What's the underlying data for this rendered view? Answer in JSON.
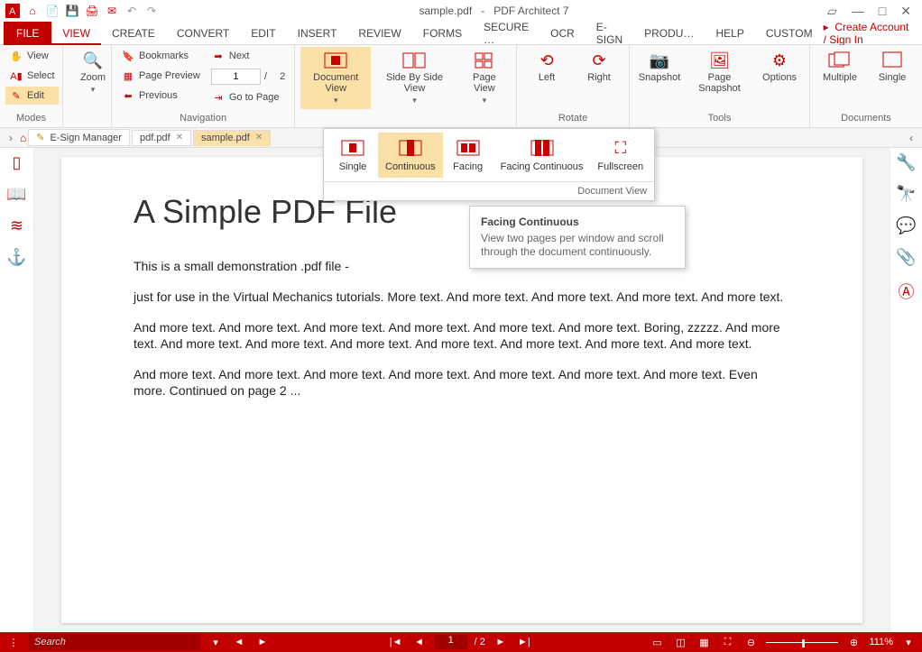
{
  "title": {
    "file": "sample.pdf",
    "sep": "-",
    "app": "PDF Architect 7"
  },
  "account": {
    "prefix": "▸",
    "text": "Create Account / Sign In"
  },
  "menu": [
    "FILE",
    "VIEW",
    "CREATE",
    "CONVERT",
    "EDIT",
    "INSERT",
    "REVIEW",
    "FORMS",
    "SECURE …",
    "OCR",
    "E-SIGN",
    "PRODU…",
    "HELP",
    "CUSTOM"
  ],
  "menu_active": 1,
  "ribbon": {
    "modes": {
      "label": "Modes",
      "view": "View",
      "select": "Select",
      "edit": "Edit"
    },
    "zoom": {
      "label": "Zoom",
      "btn": "Zoom"
    },
    "nav": {
      "label": "Navigation",
      "bookmarks": "Bookmarks",
      "preview": "Page Preview",
      "previous": "Previous",
      "next": "Next",
      "page": "1",
      "total": "2",
      "goto": "Go to Page",
      "sep": "/"
    },
    "docview": {
      "label": "Document View",
      "side": "Side By Side View",
      "page": "Page View"
    },
    "rotate": {
      "label": "Rotate",
      "left": "Left",
      "right": "Right"
    },
    "tools": {
      "label": "Tools",
      "snap": "Snapshot",
      "psnap": "Page Snapshot",
      "opts": "Options"
    },
    "docs": {
      "label": "Documents",
      "multi": "Multiple",
      "single": "Single"
    }
  },
  "tabs": {
    "t0": "E-Sign Manager",
    "t1": "pdf.pdf",
    "t2": "sample.pdf"
  },
  "dropdown": {
    "items": [
      "Single",
      "Continuous",
      "Facing",
      "Facing Continuous",
      "Fullscreen"
    ],
    "footer": "Document View",
    "selected": 1
  },
  "tooltip": {
    "title": "Facing Continuous",
    "body": "View two pages per window and scroll through the document continuously."
  },
  "doc": {
    "h1": "A Simple PDF File",
    "p1": "This is a small demonstration .pdf file -",
    "p2": "just for use in the Virtual Mechanics tutorials. More text. And more text. And more text. And more text. And more text.",
    "p3": "And more text. And more text. And more text. And more text. And more text. And more text. Boring, zzzzz. And more text. And more text. And more text. And more text. And more text. And more text. And more text. And more text.",
    "p4": "And more text. And more text. And more text. And more text. And more text. And more text. And more text. Even more. Continued on page 2 ..."
  },
  "status": {
    "search": "Search",
    "page": "1",
    "total": "/ 2",
    "zoom": "111%"
  }
}
